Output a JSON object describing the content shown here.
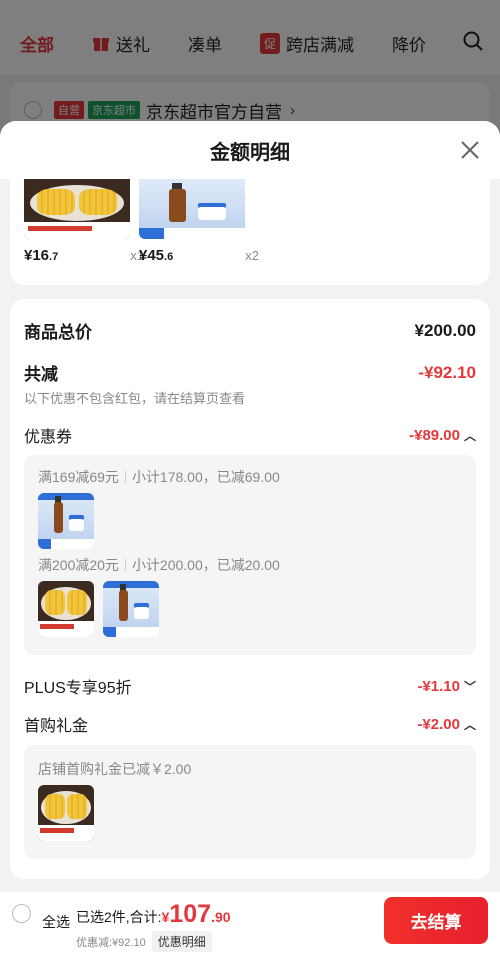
{
  "background": {
    "tabs": [
      {
        "label": "全部",
        "active": true
      },
      {
        "label": "送礼",
        "icon": "gift-icon"
      },
      {
        "label": "凑单"
      },
      {
        "label": "跨店满减",
        "icon": "promo-icon",
        "icon_text": "促"
      },
      {
        "label": "降价"
      }
    ],
    "store": {
      "tag_self": "自营",
      "tag_market": "京东超市",
      "name": "京东超市官方自营"
    }
  },
  "sheet": {
    "title": "金额明细",
    "products": [
      {
        "thumb": "corn",
        "price_int": "¥16",
        "price_dec": ".7",
        "qty": "x1"
      },
      {
        "thumb": "serum",
        "price_int": "¥45",
        "price_dec": ".6",
        "qty": "x2"
      }
    ],
    "total": {
      "label": "商品总价",
      "value": "¥200.00"
    },
    "reduce": {
      "label": "共减",
      "value": "-¥92.10",
      "note": "以下优惠不包含红包，请在结算页查看"
    },
    "coupon": {
      "label": "优惠券",
      "value": "-¥89.00",
      "groups": [
        {
          "rule": "满169减69元",
          "detail": "小计178.00，已减69.00",
          "thumbs": [
            "serum"
          ]
        },
        {
          "rule": "满200减20元",
          "detail": "小计200.00，已减20.00",
          "thumbs": [
            "corn",
            "serum"
          ]
        }
      ]
    },
    "plus": {
      "label": "PLUS专享95折",
      "value": "-¥1.10"
    },
    "first_gift": {
      "label": "首购礼金",
      "value": "-¥2.00",
      "detail": "店铺首购礼金已减￥2.00",
      "thumbs": [
        "corn"
      ]
    }
  },
  "footer": {
    "select_all": "全选",
    "summary": "已选2件,合计:",
    "total_currency": "¥",
    "total_int": "107",
    "total_dec": ".90",
    "discount": "优惠减:¥92.10",
    "detail_button": "优惠明细",
    "checkout": "去结算"
  },
  "colors": {
    "accent": "#e4393c",
    "market_green": "#1aa35a"
  }
}
